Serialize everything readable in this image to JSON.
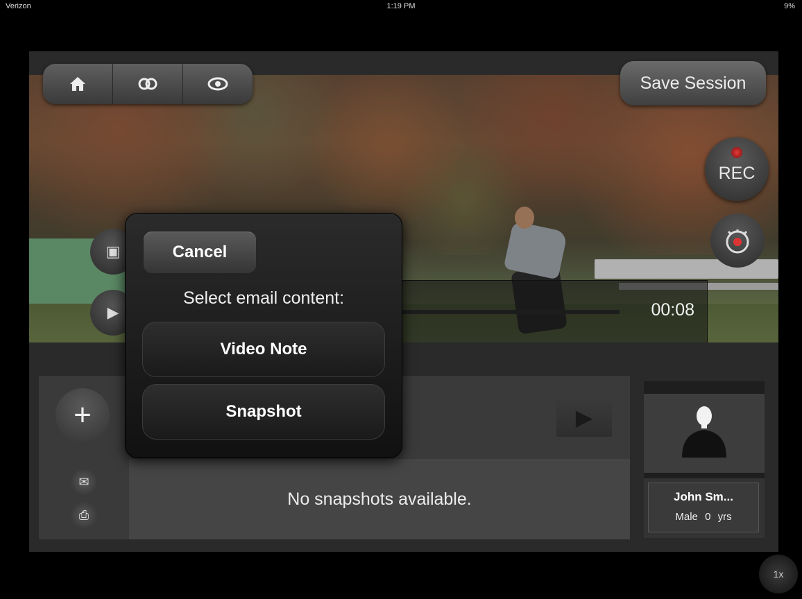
{
  "status_bar": {
    "carrier": "Verizon",
    "time": "1:19 PM",
    "battery": "9%"
  },
  "toolbar": {
    "home_icon": "home-icon",
    "link_icon": "link-icon",
    "view_icon": "eye-icon",
    "save_label": "Save Session"
  },
  "recorder": {
    "rec_label": "REC",
    "timer_icon": "stopwatch-icon"
  },
  "playback": {
    "time": "00:08",
    "compare_icon": "split-view-icon",
    "play_icon": "play-icon"
  },
  "popover": {
    "cancel_label": "Cancel",
    "title": "Select email content:",
    "options": [
      "Video Note",
      "Snapshot"
    ]
  },
  "lower_panel": {
    "add_icon": "plus-icon",
    "empty_message": "No snapshots available.",
    "email_icon": "email-icon",
    "print_icon": "printer-icon"
  },
  "profile": {
    "name": "John Sm...",
    "gender": "Male",
    "age": "0 yrs"
  },
  "speed_label": "1x"
}
